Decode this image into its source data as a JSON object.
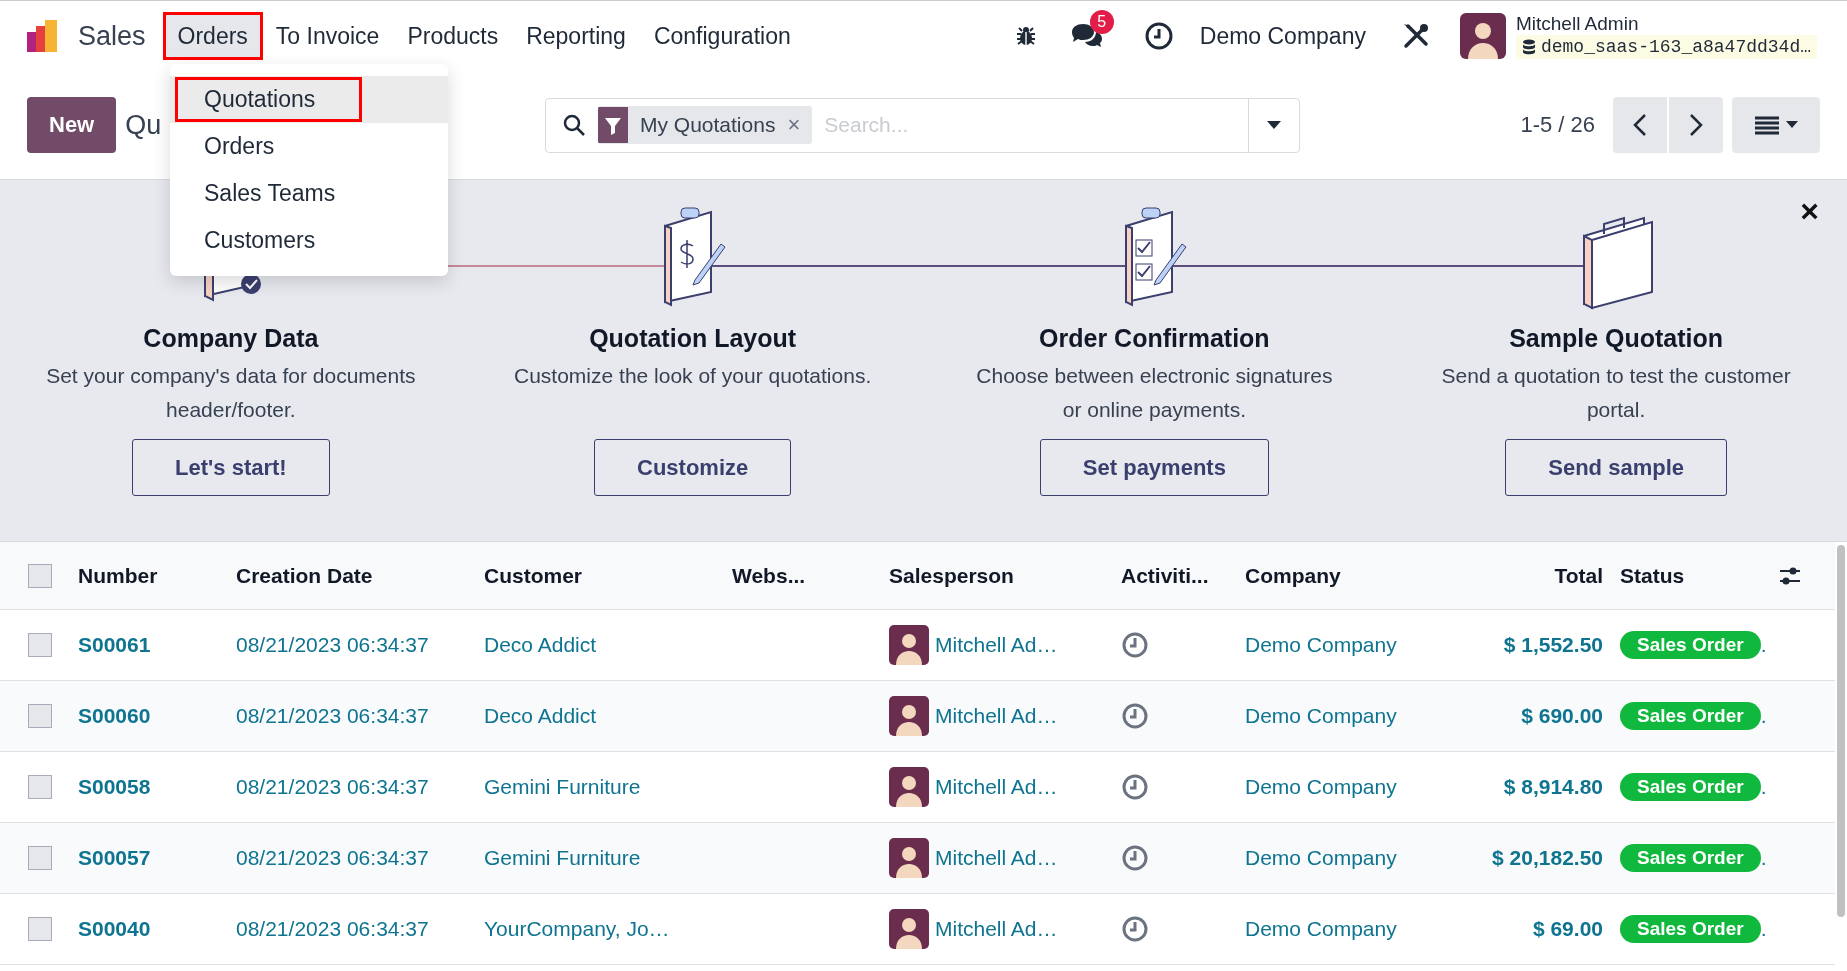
{
  "navbar": {
    "app_name": "Sales",
    "menus": [
      {
        "label": "Orders",
        "open": true,
        "annotated": true
      },
      {
        "label": "To Invoice",
        "open": false,
        "annotated": false
      },
      {
        "label": "Products",
        "open": false,
        "annotated": false
      },
      {
        "label": "Reporting",
        "open": false,
        "annotated": false
      },
      {
        "label": "Configuration",
        "open": false,
        "annotated": false
      }
    ],
    "messages_badge": "5",
    "company": "Demo Company",
    "user": {
      "name": "Mitchell Admin",
      "database": "demo_saas-163_a8a47dd34d…"
    }
  },
  "dropdown": {
    "items": [
      {
        "label": "Quotations",
        "selected": true,
        "annotated": true
      },
      {
        "label": "Orders",
        "selected": false,
        "annotated": false
      },
      {
        "label": "Sales Teams",
        "selected": false,
        "annotated": false
      },
      {
        "label": "Customers",
        "selected": false,
        "annotated": false
      }
    ]
  },
  "control_panel": {
    "new_button": "New",
    "title": "Qu",
    "search": {
      "facet": "My Quotations",
      "facet_remove": "×",
      "placeholder": "Search..."
    },
    "pager": "1-5 / 26"
  },
  "onboarding": {
    "close": "×",
    "steps": [
      {
        "kind": "company",
        "title": "Company Data",
        "description": "Set your company's data for documents header/footer.",
        "button": "Let's start!"
      },
      {
        "kind": "layout",
        "title": "Quotation Layout",
        "description": "Customize the look of your quotations.",
        "button": "Customize"
      },
      {
        "kind": "confirmation",
        "title": "Order Confirmation",
        "description": "Choose between electronic signatures or online payments.",
        "button": "Set payments"
      },
      {
        "kind": "sample",
        "title": "Sample Quotation",
        "description": "Send a quotation to test the customer portal.",
        "button": "Send sample"
      }
    ]
  },
  "table": {
    "all_checked": false,
    "columns": [
      "Number",
      "Creation Date",
      "Customer",
      "Webs...",
      "Salesperson",
      "Activiti...",
      "Company",
      "Total",
      "Status"
    ],
    "rows": [
      {
        "checked": false,
        "number": "S00061",
        "date": "08/21/2023 06:34:37",
        "customer": "Deco Addict",
        "salesperson": "Mitchell Ad…",
        "company": "Demo Company",
        "total": "$ 1,552.50",
        "status": "Sales Order",
        "after_status": "."
      },
      {
        "checked": false,
        "number": "S00060",
        "date": "08/21/2023 06:34:37",
        "customer": "Deco Addict",
        "salesperson": "Mitchell Ad…",
        "company": "Demo Company",
        "total": "$ 690.00",
        "status": "Sales Order",
        "after_status": "."
      },
      {
        "checked": false,
        "number": "S00058",
        "date": "08/21/2023 06:34:37",
        "customer": "Gemini Furniture",
        "salesperson": "Mitchell Ad…",
        "company": "Demo Company",
        "total": "$ 8,914.80",
        "status": "Sales Order",
        "after_status": "."
      },
      {
        "checked": false,
        "number": "S00057",
        "date": "08/21/2023 06:34:37",
        "customer": "Gemini Furniture",
        "salesperson": "Mitchell Ad…",
        "company": "Demo Company",
        "total": "$ 20,182.50",
        "status": "Sales Order",
        "after_status": "."
      },
      {
        "checked": false,
        "number": "S00040",
        "date": "08/21/2023 06:34:37",
        "customer": "YourCompany, Jo…",
        "salesperson": "Mitchell Ad…",
        "company": "Demo Company",
        "total": "$ 69.00",
        "status": "Sales Order",
        "after_status": "."
      }
    ]
  }
}
